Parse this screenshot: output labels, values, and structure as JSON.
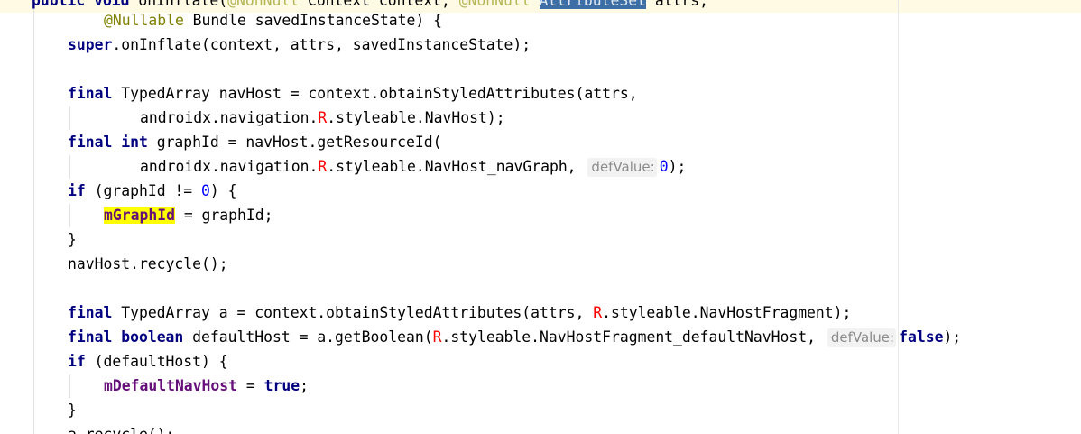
{
  "editor": {
    "code": {
      "l0": {
        "t1": "public void",
        "t2": " onInflate(",
        "t3": "@NonNull",
        "t4": " Context context, ",
        "t5": "@NonNull",
        "t6": " ",
        "t7": "AttributeSet",
        "t8": " attrs,"
      },
      "l1": {
        "t1": "@Nullable",
        "t2": " Bundle savedInstanceState) {"
      },
      "l2": {
        "t1": "super",
        "t2": ".onInflate(context, attrs, savedInstanceState);"
      },
      "l4": {
        "t1": "final",
        "t2": " TypedArray navHost = context.obtainStyledAttributes(attrs,"
      },
      "l5": {
        "t1": "androidx.navigation.",
        "t2": "R",
        "t3": ".styleable.NavHost);"
      },
      "l6": {
        "t1": "final",
        "t2": " ",
        "t3": "int",
        "t4": " graphId = navHost.getResourceId("
      },
      "l7": {
        "t1": "androidx.navigation.",
        "t2": "R",
        "t3": ".styleable.NavHost_navGraph, ",
        "hint": "defValue:",
        "t4": "0",
        "t5": ");"
      },
      "l8": {
        "t1": "if",
        "t2": " (graphId != ",
        "t3": "0",
        "t4": ") {"
      },
      "l9": {
        "t1": "mGraphId",
        "t2": " = graphId;"
      },
      "l10": {
        "t1": "}"
      },
      "l11": {
        "t1": "navHost.recycle();"
      },
      "l13": {
        "t1": "final",
        "t2": " TypedArray a = context.obtainStyledAttributes(attrs, ",
        "t3": "R",
        "t4": ".styleable.NavHostFragment);"
      },
      "l14": {
        "t1": "final",
        "t2": " ",
        "t3": "boolean",
        "t4": " defaultHost = a.getBoolean(",
        "t5": "R",
        "t6": ".styleable.NavHostFragment_defaultNavHost, ",
        "hint": "defValue:",
        "t7": "false",
        "t8": ");"
      },
      "l15": {
        "t1": "if",
        "t2": " (defaultHost) {"
      },
      "l16": {
        "t1": "mDefaultNavHost",
        "t2": " = ",
        "t3": "true",
        "t4": ";"
      },
      "l17": {
        "t1": "}"
      },
      "l18": {
        "t1": "a.recycle();"
      }
    },
    "colors": {
      "keyword": "#000080",
      "annotation": "#808000",
      "number": "#0000ff",
      "r_class": "#ff0000",
      "field": "#660e7a",
      "search_highlight": "#ffff00",
      "selection": "#3d6fa6"
    }
  }
}
